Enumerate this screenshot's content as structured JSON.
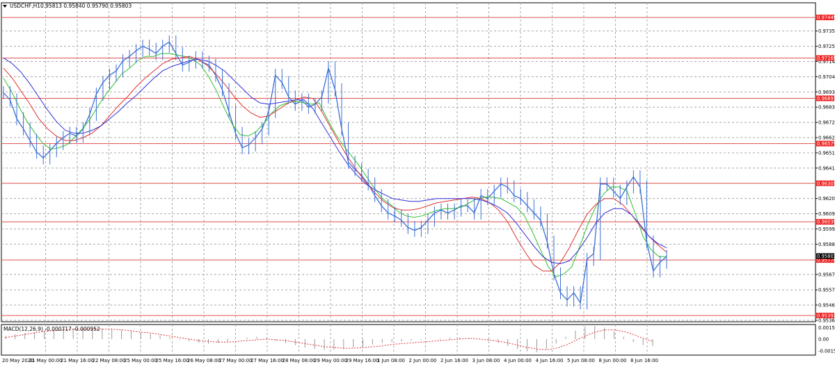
{
  "header": {
    "menu_icon": "triangle-down-icon",
    "symbol_label": "USDCHF,H1",
    "ohlc_label": "0.95813 0.95840 0.95790 0.95803"
  },
  "macd_panel": {
    "label": "MACD(12,26,9) -0.000717 -0.000952"
  },
  "colors": {
    "background": "#ffffff",
    "grid": "#a8a8a8",
    "price_line": "#3b6fd6",
    "ma_fast": "#2fbf2f",
    "ma_medium": "#e03030",
    "ma_slow": "#3030d8",
    "level_line": "#e05050",
    "level_tag_bg": "#ee2222",
    "current_tag_bg": "#000000",
    "macd_hist": "#9a9a9a",
    "macd_signal": "#e03030"
  },
  "chart_data": [
    {
      "type": "line",
      "title": "USDCHF,H1",
      "subtitle": "0.95813 0.95840 0.95790 0.95803",
      "ylim": [
        0.9535,
        0.9755
      ],
      "x_tick_labels": [
        "20 May 2020",
        "21 May 00:00",
        "21 May 16:00",
        "22 May 08:00",
        "25 May 00:00",
        "25 May 16:00",
        "26 May 08:00",
        "27 May 00:00",
        "27 May 16:00",
        "28 May 08:00",
        "29 May 00:00",
        "29 May 16:00",
        "1 Jun 08:00",
        "2 Jun 00:00",
        "2 Jun 16:00",
        "3 Jun 08:00",
        "4 Jun 00:00",
        "4 Jun 16:00",
        "5 Jun 08:00",
        "8 Jun 00:00",
        "8 Jun 16:00"
      ],
      "y_tick_labels": [
        "0.97355",
        "0.97250",
        "0.97145",
        "0.97040",
        "0.96935",
        "0.96830",
        "0.96725",
        "0.96620",
        "0.96515",
        "0.96410",
        "0.96200",
        "0.96095",
        "0.95990",
        "0.95885",
        "0.95676",
        "0.95570",
        "0.95465",
        "0.95360"
      ],
      "y_ticks": [
        0.97355,
        0.9725,
        0.97145,
        0.9704,
        0.96935,
        0.9683,
        0.96725,
        0.9662,
        0.96515,
        0.9641,
        0.962,
        0.96095,
        0.9599,
        0.95885,
        0.95676,
        0.9557,
        0.95465,
        0.9536
      ],
      "levels": [
        {
          "value": 0.97449,
          "label": "0.97449"
        },
        {
          "value": 0.97169,
          "label": "0.97169"
        },
        {
          "value": 0.96891,
          "label": "0.96891"
        },
        {
          "value": 0.96579,
          "label": "0.96579"
        },
        {
          "value": 0.96305,
          "label": "0.96305"
        },
        {
          "value": 0.96039,
          "label": "0.96039"
        },
        {
          "value": 0.95776,
          "label": "0.95776"
        },
        {
          "value": 0.95393,
          "label": "0.95393"
        }
      ],
      "current_price": {
        "value": 0.95803,
        "label": "0.95803"
      },
      "x": [
        0,
        3,
        6,
        9,
        12,
        15,
        18,
        21,
        24,
        27,
        30,
        33,
        36,
        39,
        42,
        45,
        48,
        51,
        54,
        57,
        60,
        63,
        66,
        69,
        72,
        75,
        78,
        81,
        84,
        87,
        90,
        93,
        96,
        99,
        102,
        105,
        108,
        111,
        114,
        117,
        120,
        123,
        126,
        129,
        132,
        135,
        138,
        141,
        144,
        147,
        150,
        153,
        156,
        159,
        162,
        165,
        168,
        171,
        174,
        177,
        180,
        183,
        186,
        189,
        192,
        195,
        198,
        201,
        204,
        207,
        210,
        213,
        216,
        219,
        222,
        225,
        228,
        231,
        234,
        237,
        240,
        243,
        246,
        249,
        252,
        255,
        258,
        261,
        264,
        267,
        270,
        273,
        276,
        279,
        282,
        285,
        288,
        291,
        294,
        297,
        300
      ],
      "series": [
        {
          "values": [
            0.9693,
            0.9688,
            0.9675,
            0.9668,
            0.966,
            0.9652,
            0.9648,
            0.9653,
            0.9658,
            0.9662,
            0.9665,
            0.9663,
            0.9668,
            0.9678,
            0.9692,
            0.97,
            0.9705,
            0.9708,
            0.9715,
            0.9718,
            0.9722,
            0.9725,
            0.9723,
            0.972,
            0.9725,
            0.9728,
            0.972,
            0.9712,
            0.9714,
            0.9717,
            0.9714,
            0.9712,
            0.9705,
            0.9695,
            0.968,
            0.9665,
            0.9655,
            0.9657,
            0.9662,
            0.9668,
            0.968,
            0.9705,
            0.97,
            0.969,
            0.9685,
            0.9688,
            0.9683,
            0.9685,
            0.969,
            0.971,
            0.9695,
            0.9668,
            0.9645,
            0.964,
            0.9636,
            0.963,
            0.9622,
            0.9615,
            0.961,
            0.9608,
            0.9605,
            0.96,
            0.9598,
            0.96,
            0.9605,
            0.961,
            0.9612,
            0.961,
            0.9612,
            0.9615,
            0.9615,
            0.961,
            0.9622,
            0.962,
            0.9625,
            0.963,
            0.9628,
            0.9622,
            0.962,
            0.9615,
            0.961,
            0.9605,
            0.959,
            0.9568,
            0.9555,
            0.955,
            0.9555,
            0.9548,
            0.9578,
            0.9582,
            0.963,
            0.963,
            0.9625,
            0.962,
            0.9628,
            0.9635,
            0.9628,
            0.959,
            0.957,
            0.9576,
            0.958
          ]
        },
        {
          "values": [
            0.9703,
            0.9694,
            0.9683,
            0.9673,
            0.9665,
            0.9658,
            0.9654,
            0.9655,
            0.9657,
            0.9662,
            0.9668,
            0.9675,
            0.9684,
            0.9692,
            0.9699,
            0.9706,
            0.971,
            0.9715,
            0.9718,
            0.9718,
            0.972,
            0.972,
            0.9719,
            0.9718,
            0.9716,
            0.9712,
            0.9704,
            0.9694,
            0.9682,
            0.9671,
            0.9664,
            0.9663,
            0.9666,
            0.9672,
            0.9679,
            0.9684,
            0.9686,
            0.9687,
            0.9686,
            0.9685,
            0.9686,
            0.9675,
            0.9665,
            0.9657,
            0.965,
            0.9643,
            0.9635,
            0.9627,
            0.962,
            0.9616,
            0.9611,
            0.9608,
            0.9607,
            0.9608,
            0.961,
            0.9612,
            0.9613,
            0.9613,
            0.9614,
            0.9617,
            0.962,
            0.9621,
            0.9621,
            0.962,
            0.9617,
            0.9614,
            0.9608,
            0.9597,
            0.9585,
            0.9573,
            0.9566,
            0.9568,
            0.9573,
            0.9587,
            0.9602,
            0.9614,
            0.9623,
            0.9628,
            0.9628,
            0.9625,
            0.961,
            0.9594,
            0.9585,
            0.958,
            0.958
          ]
        },
        {
          "values": [
            0.971,
            0.9703,
            0.9694,
            0.9685,
            0.9675,
            0.9668,
            0.9663,
            0.966,
            0.966,
            0.9662,
            0.9665,
            0.967,
            0.9677,
            0.9684,
            0.969,
            0.9697,
            0.9703,
            0.9708,
            0.9713,
            0.9716,
            0.9717,
            0.9718,
            0.9716,
            0.9712,
            0.9706,
            0.9699,
            0.9691,
            0.9684,
            0.9679,
            0.9676,
            0.9677,
            0.9681,
            0.9685,
            0.9688,
            0.969,
            0.9689,
            0.968,
            0.9669,
            0.9658,
            0.9648,
            0.9639,
            0.9631,
            0.9624,
            0.9618,
            0.9614,
            0.9612,
            0.9612,
            0.9613,
            0.9615,
            0.9617,
            0.9618,
            0.9619,
            0.962,
            0.9621,
            0.962,
            0.9617,
            0.9612,
            0.9604,
            0.9593,
            0.9583,
            0.9574,
            0.957,
            0.957,
            0.9576,
            0.9586,
            0.9598,
            0.9609,
            0.9616,
            0.962,
            0.962,
            0.9616,
            0.9609,
            0.9601,
            0.9594,
            0.9588,
            0.9583
          ]
        },
        {
          "values": [
            0.9717,
            0.9713,
            0.9707,
            0.9699,
            0.969,
            0.9681,
            0.9673,
            0.9667,
            0.9665,
            0.9665,
            0.9667,
            0.967,
            0.9675,
            0.968,
            0.9686,
            0.9691,
            0.9697,
            0.9703,
            0.9708,
            0.9711,
            0.9713,
            0.9715,
            0.9716,
            0.9715,
            0.9712,
            0.9708,
            0.9702,
            0.9696,
            0.969,
            0.9686,
            0.9685,
            0.9686,
            0.9687,
            0.9688,
            0.9688,
            0.9682,
            0.9672,
            0.9662,
            0.9652,
            0.9643,
            0.9636,
            0.963,
            0.9626,
            0.9623,
            0.962,
            0.9619,
            0.9618,
            0.9618,
            0.9619,
            0.962,
            0.962,
            0.962,
            0.962,
            0.962,
            0.9619,
            0.9617,
            0.9614,
            0.961,
            0.9603,
            0.9595,
            0.9587,
            0.958,
            0.9576,
            0.9575,
            0.9577,
            0.9584,
            0.9593,
            0.9603,
            0.961,
            0.9613,
            0.9613,
            0.9609,
            0.9602,
            0.9594,
            0.9589,
            0.9586
          ]
        }
      ]
    },
    {
      "type": "bar",
      "title": "MACD(12,26,9)",
      "subtitle": "-0.000717 -0.000952",
      "y_tick_labels": [
        "0.00150",
        "0.00",
        "-0.00155"
      ],
      "y_ticks": [
        0.0015,
        0,
        -0.00155
      ],
      "ylim": [
        -0.0021,
        0.0019
      ],
      "hist_values": [
        0.0004,
        0.0006,
        0.0008,
        0.0009,
        0.0011,
        0.0012,
        0.0013,
        0.0013,
        0.0014,
        0.0014,
        0.0014,
        0.0013,
        0.0012,
        0.0011,
        0.0009,
        0.0007,
        0.0005,
        0.0002,
        -0.0001,
        -0.0003,
        -0.0005,
        -0.0006,
        -0.0005,
        -0.0003,
        0.0,
        0.0002,
        0.0003,
        0.0001,
        -0.0002,
        -0.0005,
        -0.0008,
        -0.0011,
        -0.0013,
        -0.0014,
        -0.0014,
        -0.0013,
        -0.0011,
        -0.0009,
        -0.0007,
        -0.0005,
        -0.0004,
        -0.0003,
        -0.0002,
        -0.0001,
        0.0,
        0.0001,
        0.0002,
        0.0002,
        0.0001,
        0.0,
        -0.0002,
        -0.0005,
        -0.0009,
        -0.0013,
        -0.0016,
        -0.0017,
        -0.0013,
        -0.0006,
        0.0003,
        0.0011,
        0.0016,
        0.0017,
        0.0015,
        0.001,
        0.0003,
        -0.0004,
        -0.0008,
        -0.0009
      ],
      "signal_values": [
        0.0002,
        0.0004,
        0.0006,
        0.0008,
        0.001,
        0.0011,
        0.0012,
        0.0013,
        0.0013,
        0.0013,
        0.0013,
        0.0013,
        0.0012,
        0.0011,
        0.0009,
        0.0008,
        0.0006,
        0.0004,
        0.0002,
        0.0,
        -0.0002,
        -0.0003,
        -0.0004,
        -0.0004,
        -0.0003,
        -0.0002,
        -0.0001,
        0.0,
        -0.0001,
        -0.0002,
        -0.0004,
        -0.0006,
        -0.0008,
        -0.001,
        -0.0011,
        -0.0012,
        -0.0012,
        -0.0011,
        -0.001,
        -0.0009,
        -0.0007,
        -0.0006,
        -0.0005,
        -0.0004,
        -0.0003,
        -0.0002,
        -0.0001,
        0.0,
        0.0001,
        0.0,
        -0.0001,
        -0.0003,
        -0.0005,
        -0.0008,
        -0.0011,
        -0.0013,
        -0.0014,
        -0.0012,
        -0.0008,
        -0.0002,
        0.0004,
        0.0009,
        0.0012,
        0.0012,
        0.001,
        0.0006,
        0.0001,
        -0.0003
      ]
    }
  ]
}
